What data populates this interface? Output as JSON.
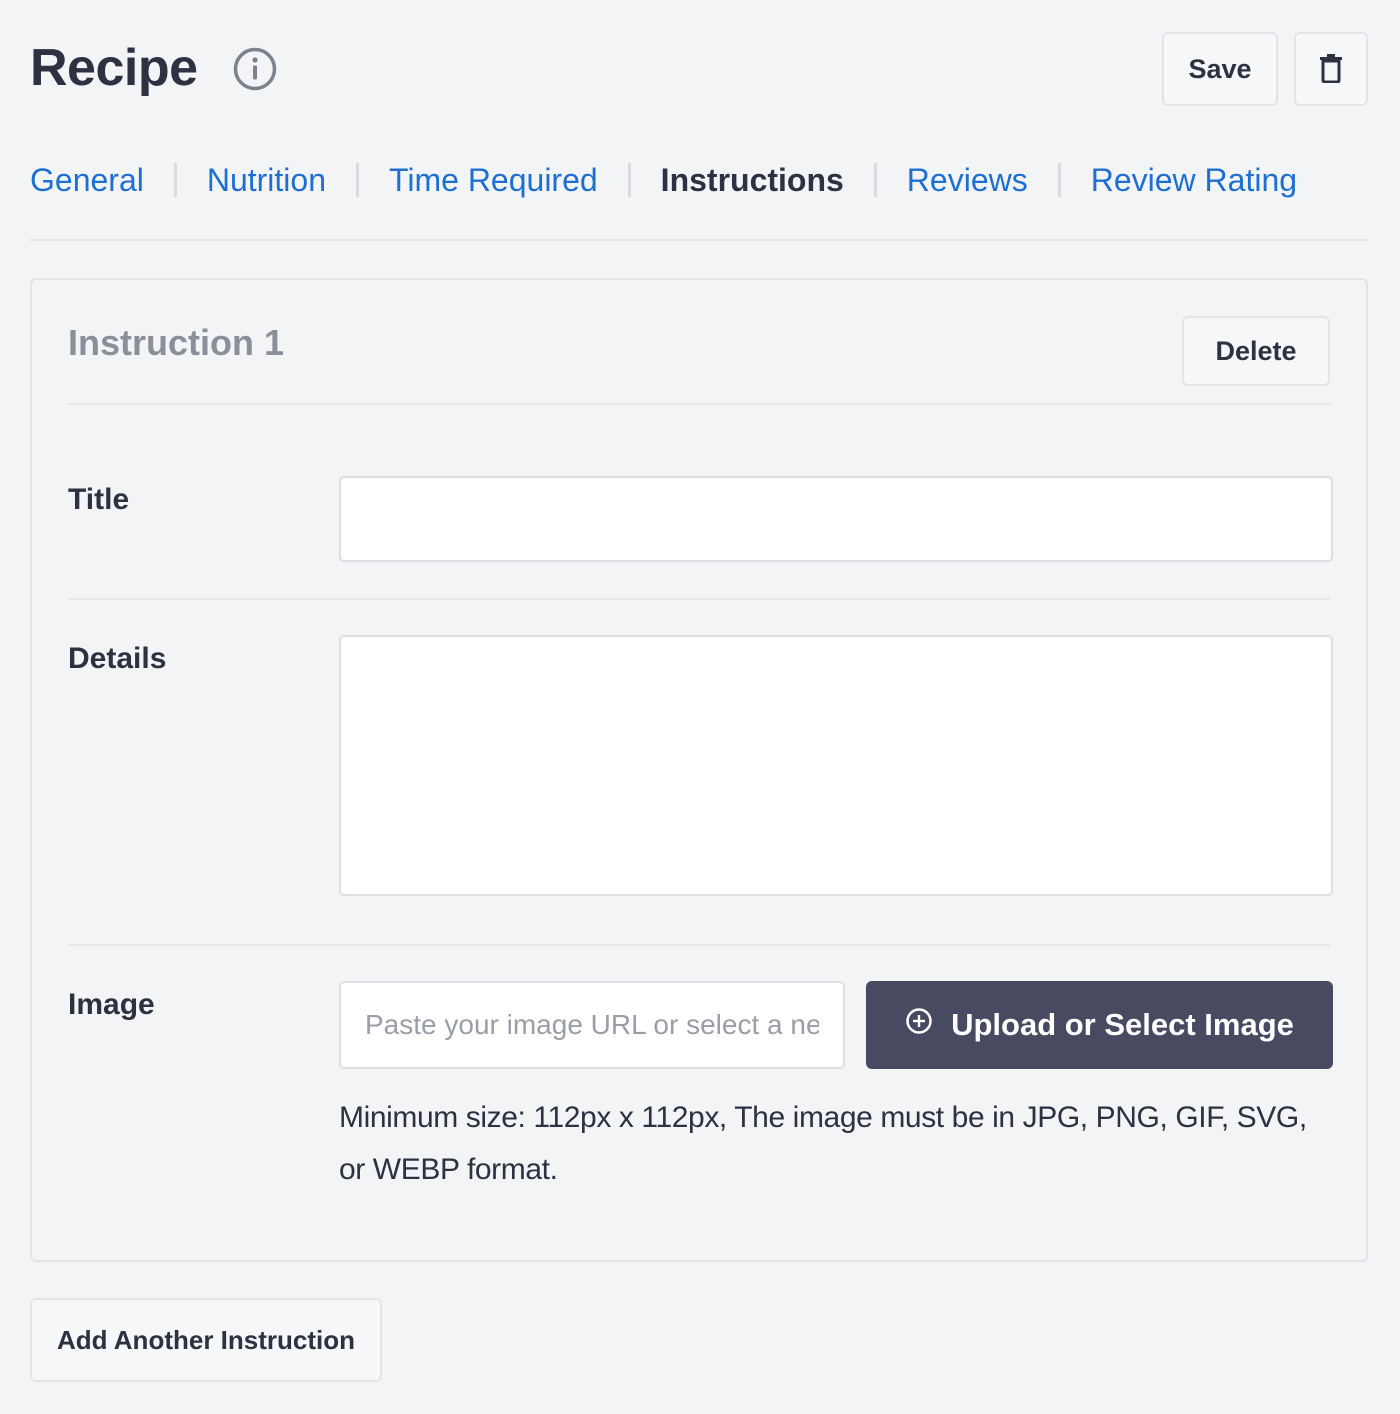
{
  "header": {
    "title": "Recipe",
    "save_label": "Save"
  },
  "tabs": [
    {
      "label": "General",
      "active": false
    },
    {
      "label": "Nutrition",
      "active": false
    },
    {
      "label": "Time Required",
      "active": false
    },
    {
      "label": "Instructions",
      "active": true
    },
    {
      "label": "Reviews",
      "active": false
    },
    {
      "label": "Review Rating",
      "active": false
    }
  ],
  "instruction": {
    "title": "Instruction 1",
    "delete_label": "Delete",
    "fields": {
      "title_label": "Title",
      "title_value": "",
      "details_label": "Details",
      "details_value": "",
      "image_label": "Image",
      "image_value": "",
      "image_placeholder": "Paste your image URL or select a new image",
      "upload_label": "Upload or Select Image",
      "help_text": "Minimum size: 112px x 112px, The image must be in JPG, PNG, GIF, SVG, or WEBP format."
    }
  },
  "footer": {
    "add_label": "Add Another Instruction"
  },
  "colors": {
    "link": "#1d6fd1",
    "text": "#2d3142",
    "primary_button": "#474a61",
    "muted_title": "#8a8f99"
  },
  "icons": {
    "info": "info-circle-icon",
    "trash": "trash-icon",
    "upload": "plus-circle-icon"
  }
}
